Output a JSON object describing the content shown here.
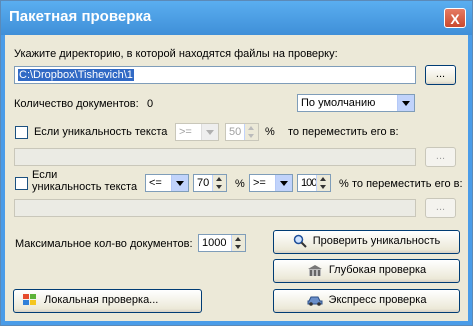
{
  "window": {
    "title": "Пакетная проверка",
    "close_glyph": "X"
  },
  "directory": {
    "label": "Укажите директорию, в которой находятся файлы на проверку:",
    "path": "C:\\Dropbox\\Tishevich\\1",
    "browse_label": "..."
  },
  "doc_count": {
    "label": "Количество документов:",
    "value": "0"
  },
  "mode_select": {
    "value": "По умолчанию"
  },
  "rule1": {
    "label": "Если уникальность текста",
    "operator": ">=",
    "value": "50",
    "percent": "%",
    "action_label": "то переместить его в:",
    "browse_label": "..."
  },
  "rule2": {
    "label_line1": "Если",
    "label_line2": "уникальность текста",
    "operator1": "<=",
    "value1": "70",
    "percent1": "%",
    "operator2": ">=",
    "value2": "100",
    "percent2": "%",
    "action_label": "то переместить его в:",
    "browse_label": "..."
  },
  "max_docs": {
    "label": "Максимальное кол-во документов:",
    "value": "1000"
  },
  "buttons": {
    "check_unique": "Проверить уникальность",
    "deep_check": "Глубокая проверка",
    "local_check": "Локальная проверка...",
    "express_check": "Экспресс проверка"
  },
  "icons": {
    "check_unique": "magnifier-icon",
    "deep_check": "building-icon",
    "local_check": "windows-logo-icon",
    "express_check": "car-icon"
  }
}
